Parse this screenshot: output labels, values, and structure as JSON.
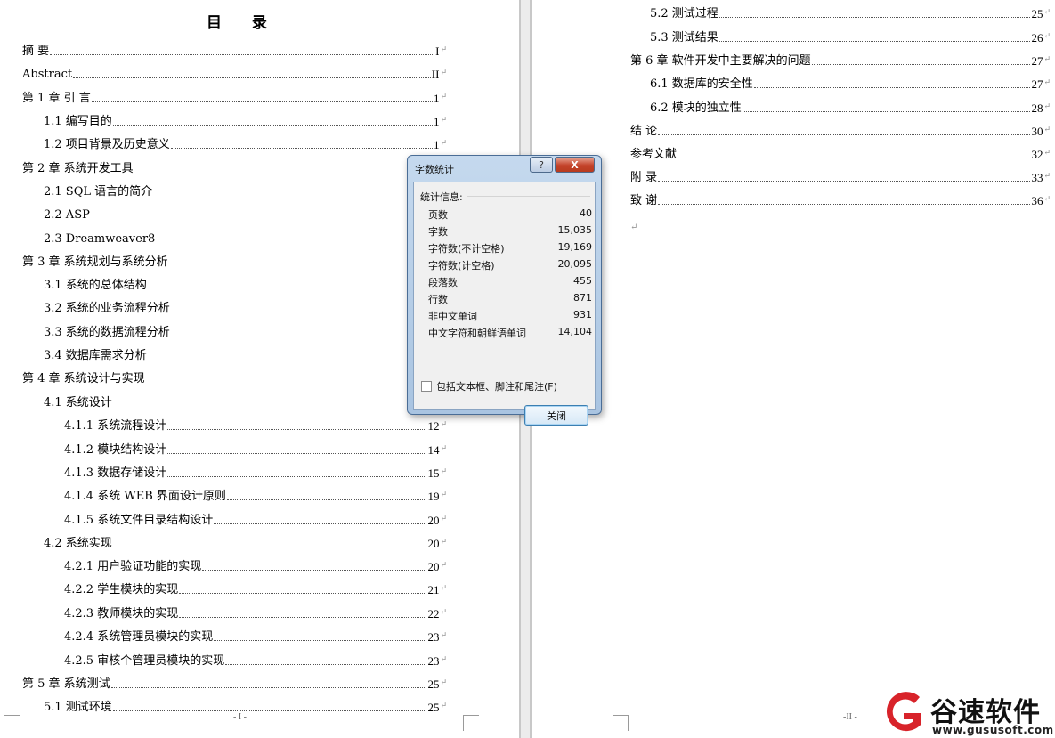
{
  "left_page": {
    "title": "目  录",
    "footer": "- I -",
    "entries": [
      {
        "text": "摘    要",
        "page": "I"
      },
      {
        "text": "Abstract",
        "page": "II"
      },
      {
        "text": "第 1 章  引  言",
        "page": "1"
      },
      {
        "text": "1.1 编写目的",
        "page": "1"
      },
      {
        "text": "1.2 项目背景及历史意义",
        "page": "1"
      },
      {
        "text": "第 2 章  系统开发工具",
        "page": ""
      },
      {
        "text": "2.1 SQL 语言的简介",
        "page": ""
      },
      {
        "text": "2.2 ASP",
        "page": ""
      },
      {
        "text": "2.3 Dreamweaver8",
        "page": ""
      },
      {
        "text": "第 3 章  系统规划与系统分析",
        "page": ""
      },
      {
        "text": "3.1  系统的总体结构",
        "page": ""
      },
      {
        "text": "3.2  系统的业务流程分析",
        "page": ""
      },
      {
        "text": "3.3  系统的数据流程分析",
        "page": ""
      },
      {
        "text": "3.4  数据库需求分析",
        "page": ""
      },
      {
        "text": "第 4 章  系统设计与实现",
        "page": ""
      },
      {
        "text": "4.1  系统设计",
        "page": ""
      },
      {
        "text": "4.1.1  系统流程设计",
        "page": "12"
      },
      {
        "text": "4.1.2  模块结构设计",
        "page": "14"
      },
      {
        "text": "4.1.3  数据存储设计",
        "page": "15"
      },
      {
        "text": "4.1.4  系统 WEB 界面设计原则",
        "page": "19"
      },
      {
        "text": "4.1.5  系统文件目录结构设计",
        "page": "20"
      },
      {
        "text": "4.2  系统实现",
        "page": "20"
      },
      {
        "text": "4.2.1  用户验证功能的实现",
        "page": "20"
      },
      {
        "text": "4.2.2  学生模块的实现",
        "page": "21"
      },
      {
        "text": "4.2.3  教师模块的实现",
        "page": "22"
      },
      {
        "text": "4.2.4  系统管理员模块的实现",
        "page": "23"
      },
      {
        "text": "4.2.5  审核个管理员模块的实现",
        "page": "23"
      },
      {
        "text": "第 5 章  系统测试",
        "page": "25"
      },
      {
        "text": "5.1  测试环境",
        "page": "25"
      }
    ]
  },
  "right_page": {
    "footer": "-II -",
    "entries": [
      {
        "text": "5.2  测试过程",
        "page": "25"
      },
      {
        "text": "5.3  测试结果",
        "page": "26"
      },
      {
        "text": "第 6 章  软件开发中主要解决的问题",
        "page": "27"
      },
      {
        "text": "6.1 数据库的安全性",
        "page": "27"
      },
      {
        "text": "6.2 模块的独立性",
        "page": "28"
      },
      {
        "text": "结  论",
        "page": "30"
      },
      {
        "text": "参考文献",
        "page": "32"
      },
      {
        "text": "附    录",
        "page": "33"
      },
      {
        "text": "致    谢",
        "page": "36"
      }
    ]
  },
  "dialog": {
    "title": "字数统计",
    "help": "?",
    "close_x": "X",
    "group_label": "统计信息:",
    "stats": [
      {
        "label": "页数",
        "value": "40"
      },
      {
        "label": "字数",
        "value": "15,035"
      },
      {
        "label": "字符数(不计空格)",
        "value": "19,169"
      },
      {
        "label": "字符数(计空格)",
        "value": "20,095"
      },
      {
        "label": "段落数",
        "value": "455"
      },
      {
        "label": "行数",
        "value": "871"
      },
      {
        "label": "非中文单词",
        "value": "931"
      },
      {
        "label": "中文字符和朝鲜语单词",
        "value": "14,104"
      }
    ],
    "checkbox_label": "包括文本框、脚注和尾注(F)",
    "checkbox_checked": false,
    "close_button": "关闭"
  },
  "watermark": {
    "brand": "谷速软件",
    "url": "www.gususoft.com"
  },
  "colors": {
    "logo_red": "#d8232a",
    "dialog_frame": "#a9c4e1",
    "close_x": "#c4432a"
  }
}
